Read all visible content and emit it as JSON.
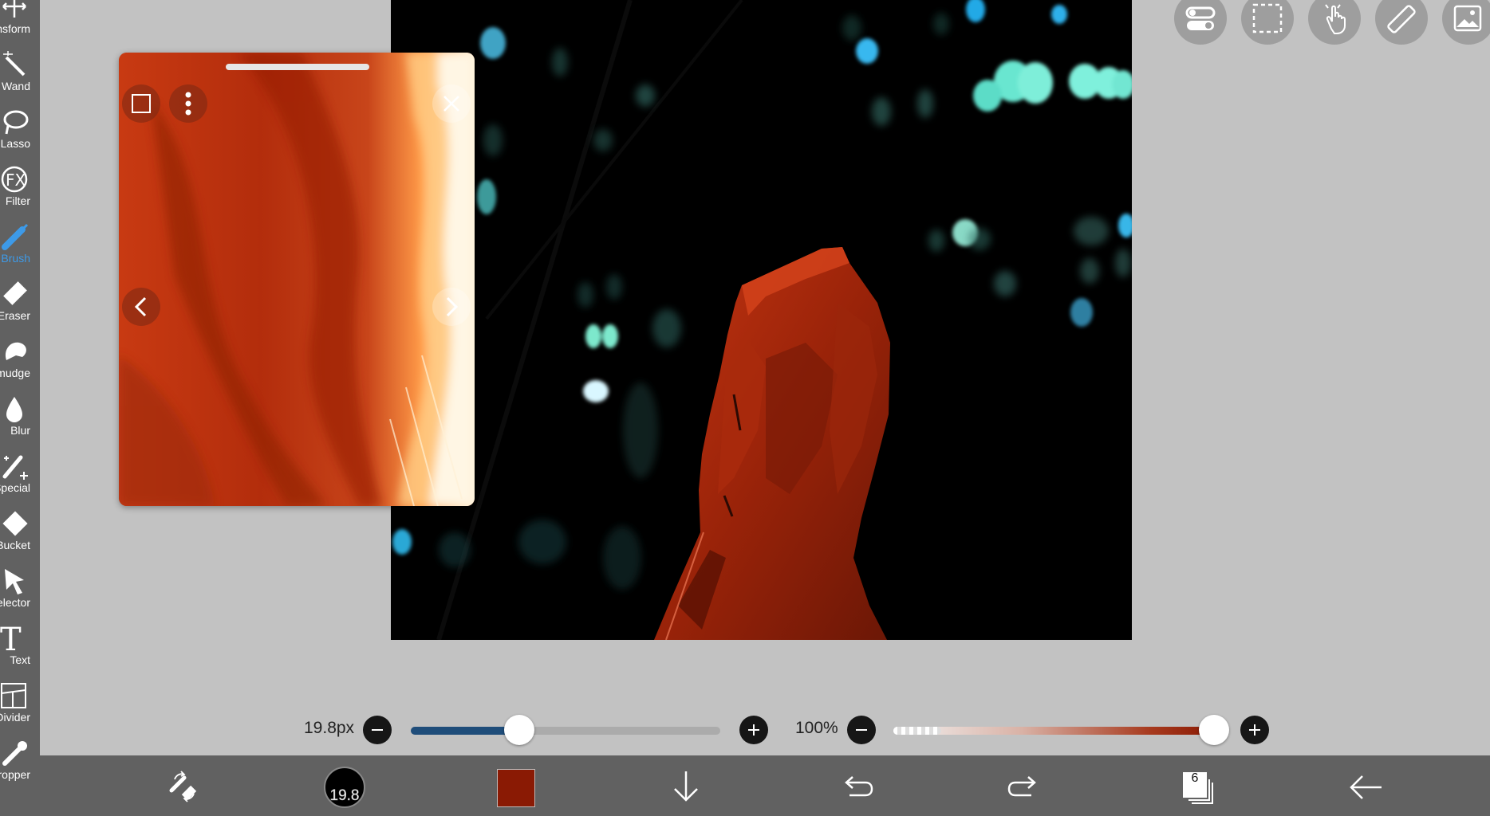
{
  "tools": [
    {
      "id": "transform",
      "label": "Transform",
      "icon": "transform-icon",
      "active": false
    },
    {
      "id": "magic-wand",
      "label": "Magic Wand",
      "icon": "magic-wand-icon",
      "active": false
    },
    {
      "id": "lasso",
      "label": "Lasso",
      "icon": "lasso-icon",
      "active": false
    },
    {
      "id": "filter",
      "label": "Filter",
      "icon": "fx-icon",
      "active": false
    },
    {
      "id": "brush",
      "label": "Brush",
      "icon": "brush-icon",
      "active": true
    },
    {
      "id": "eraser",
      "label": "Eraser",
      "icon": "eraser-icon",
      "active": false
    },
    {
      "id": "smudge",
      "label": "Smudge",
      "icon": "smudge-icon",
      "active": false
    },
    {
      "id": "blur",
      "label": "Blur",
      "icon": "blur-icon",
      "active": false
    },
    {
      "id": "special",
      "label": "Special",
      "icon": "special-brush-icon",
      "active": false
    },
    {
      "id": "bucket",
      "label": "Bucket",
      "icon": "bucket-icon",
      "active": false
    },
    {
      "id": "selector",
      "label": "Selector",
      "icon": "selector-icon",
      "active": false
    },
    {
      "id": "text",
      "label": "Text",
      "icon": "text-icon",
      "active": false
    },
    {
      "id": "frame-divider",
      "label": "Frame Divider",
      "icon": "frame-divider-icon",
      "active": false
    },
    {
      "id": "eyedropper",
      "label": "Eyedropper",
      "icon": "eyedropper-icon",
      "active": false
    }
  ],
  "brush_size": {
    "label": "19.8px",
    "value": 19.8,
    "min": 0,
    "max": 60,
    "fraction": 0.35
  },
  "opacity": {
    "label": "100%",
    "value": 100,
    "fraction": 1.0
  },
  "bottom_bar": {
    "brush_badge": "19.8",
    "layers_count": "6",
    "color": "#8a1a04"
  },
  "colors": {
    "accent": "#3d9ae8",
    "toolbar": "#616161",
    "workspace": "#c2c2c2",
    "slider_fill": "#1f4d7a",
    "current_color": "#8a1a04"
  }
}
